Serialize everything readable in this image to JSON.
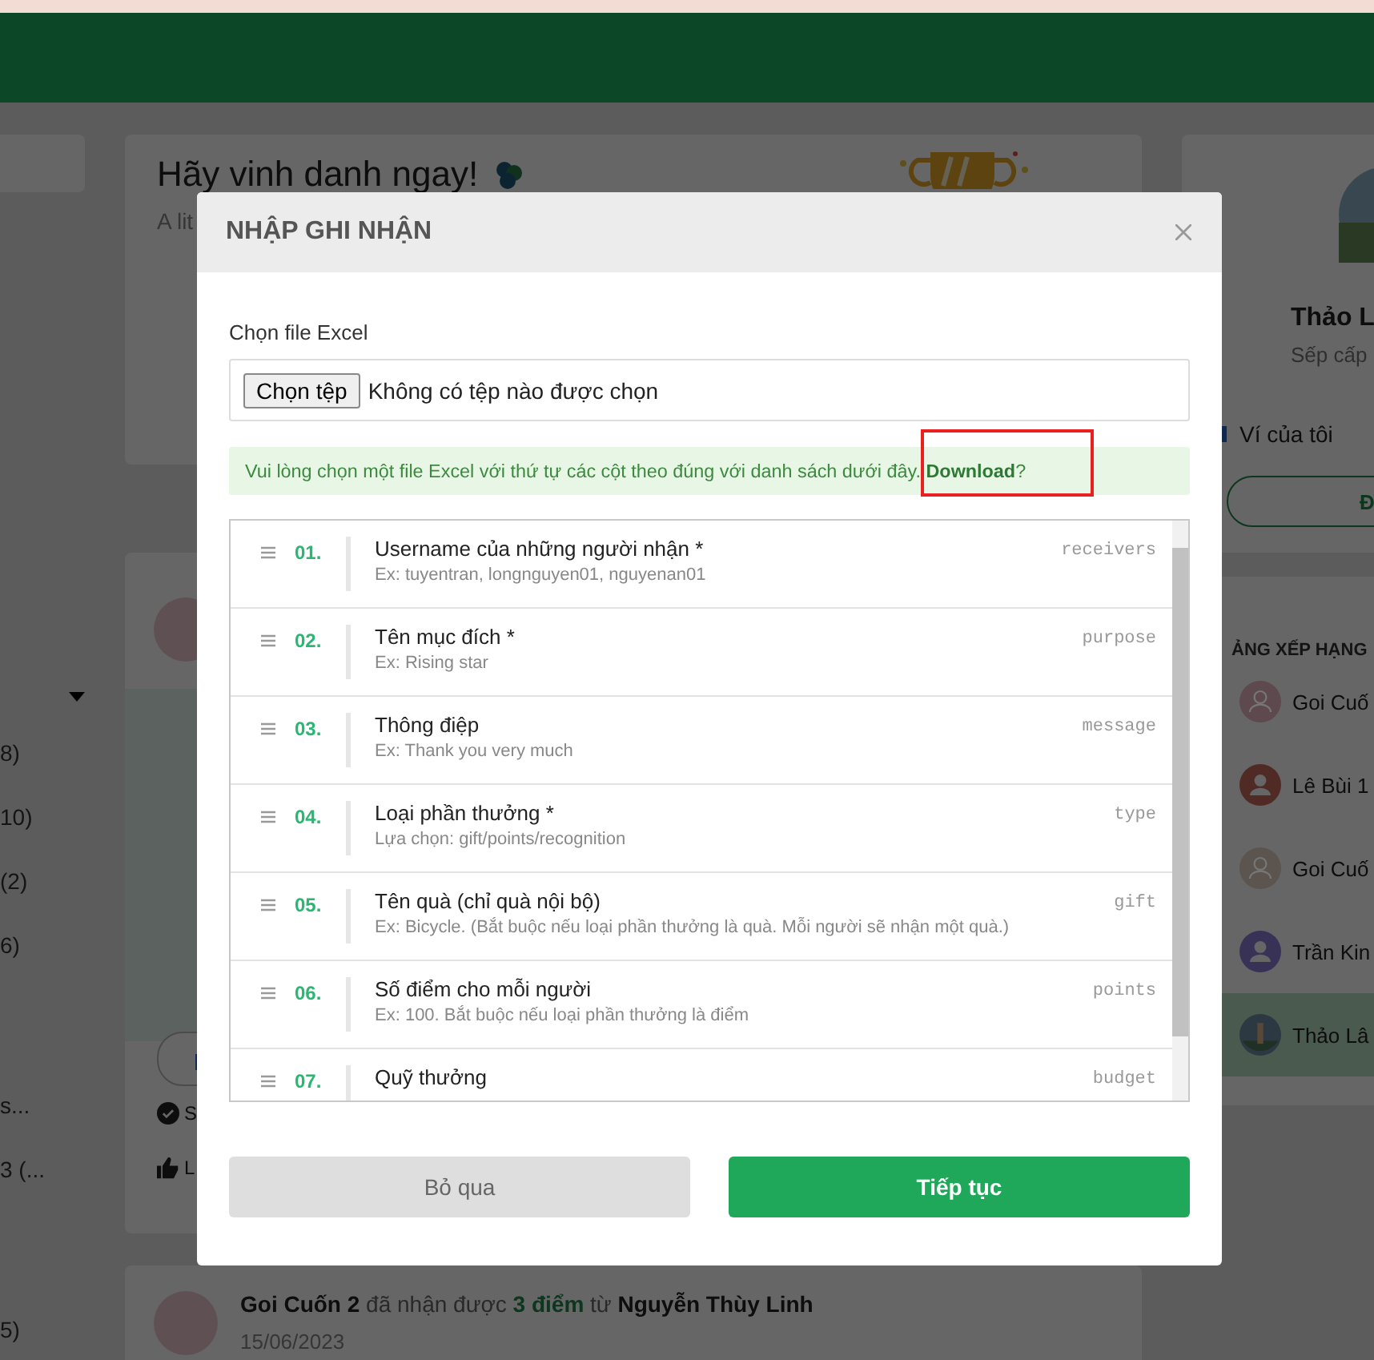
{
  "sidebar": {
    "groups": [
      {
        "items": [
          "8)",
          "10)",
          "(2)",
          "6)"
        ]
      },
      {
        "items": [
          "s...",
          "3 (..."
        ]
      },
      {
        "items": [
          "5)"
        ]
      }
    ]
  },
  "hero": {
    "title": "Hãy vinh danh ngay!",
    "subtitle": "A lit"
  },
  "post": {
    "actions": [
      {
        "kind": "check",
        "label": "S"
      },
      {
        "kind": "like",
        "label": "L"
      }
    ]
  },
  "feed_item": {
    "receiver": "Goi Cuốn 2",
    "verb": "đã nhận được",
    "amount": "3 điểm",
    "from_word": "từ",
    "sender": "Nguyễn Thùy Linh",
    "date": "15/06/2023"
  },
  "profile": {
    "name": "Thảo L",
    "role": "Sếp cấp",
    "wallet_label": "Ví của tôi",
    "button": "Đ"
  },
  "leaderboard": {
    "title": "ẢNG XẾP HẠNG",
    "rows": [
      {
        "name": "Goi Cuố",
        "kind": "outline",
        "color": "#5d494e",
        "selected": false
      },
      {
        "name": "Lê Bùi 1",
        "kind": "person",
        "color": "#502a24",
        "selected": false
      },
      {
        "name": "Goi Cuố",
        "kind": "outline",
        "color": "#5b544f",
        "selected": false
      },
      {
        "name": "Trần Kin",
        "kind": "person",
        "color": "#383356",
        "selected": false
      },
      {
        "name": "Thảo Lâ",
        "color": "#2c3943",
        "selected": true
      }
    ]
  },
  "modal": {
    "title": "NHẬP GHI NHẬN",
    "file_label": "Chọn file Excel",
    "file_button": "Chọn tệp",
    "file_status": "Không có tệp nào được chọn",
    "notice": "Vui lòng chọn một file Excel với thứ tự các cột theo đúng với danh sách dưới đây.",
    "notice_link": "Download",
    "notice_end": "?",
    "columns": [
      {
        "number": "01.",
        "title": "Username của những người nhận *",
        "example": "Ex: tuyentran, longnguyen01, nguyenan01",
        "key": "receivers"
      },
      {
        "number": "02.",
        "title": "Tên mục đích *",
        "example": "Ex: Rising star",
        "key": "purpose"
      },
      {
        "number": "03.",
        "title": "Thông điệp",
        "example": "Ex: Thank you very much",
        "key": "message"
      },
      {
        "number": "04.",
        "title": "Loại phần thưởng *",
        "example": "Lựa chọn: gift/points/recognition",
        "key": "type"
      },
      {
        "number": "05.",
        "title": "Tên quà (chỉ quà nội bộ)",
        "example": "Ex: Bicycle. (Bắt buộc nếu loại phần thưởng là quà. Mỗi người sẽ nhận một quà.)",
        "key": "gift"
      },
      {
        "number": "06.",
        "title": "Số điểm cho mỗi người",
        "example": "Ex: 100. Bắt buộc nếu loại phần thưởng là điểm",
        "key": "points"
      },
      {
        "number": "07.",
        "title": "Quỹ thưởng",
        "key": "budget"
      }
    ],
    "cancel_button": "Bỏ qua",
    "submit_button": "Tiếp tục"
  }
}
